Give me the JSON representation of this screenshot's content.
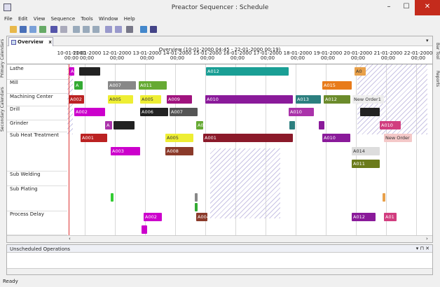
{
  "window": {
    "title": "Preactor Sequencer : Schedule",
    "minimize": "–",
    "maximize": "☐",
    "close": "✕"
  },
  "menu": [
    "File",
    "Edit",
    "View",
    "Sequence",
    "Tools",
    "Window",
    "Help"
  ],
  "left_tabs": [
    "Primary Calendars",
    "Secondary Calendars"
  ],
  "right_tabs": [
    "Bar Tool",
    "Reports"
  ],
  "doc_tab": {
    "label": "Overview",
    "close": "x",
    "menu": "▾"
  },
  "overview_label": "Overview   (10-01-2000 04:45 - 22-01-2000 00:19)",
  "dates": [
    {
      "d": "10-01-2000",
      "t": "00:00"
    },
    {
      "d": "11-01-2000",
      "t": "00;00"
    },
    {
      "d": "12-01-2000",
      "t": "00;00"
    },
    {
      "d": "13-01-2000",
      "t": "00;00"
    },
    {
      "d": "14-01-2000",
      "t": "00;00"
    },
    {
      "d": "15-01-2000",
      "t": "00;00"
    },
    {
      "d": "16-01-2000",
      "t": "00;00"
    },
    {
      "d": "17-01-2000",
      "t": "00;00"
    },
    {
      "d": "18-01-2000",
      "t": "00;00"
    },
    {
      "d": "19-01-2000",
      "t": "00;00"
    },
    {
      "d": "20-01-2000",
      "t": "00;00"
    },
    {
      "d": "21-01-2000",
      "t": "00;00"
    },
    {
      "d": "22-01-2000",
      "t": "00;00"
    }
  ],
  "resources": [
    {
      "name": "Lathe"
    },
    {
      "name": "Mill"
    },
    {
      "name": "Machining Center"
    },
    {
      "name": "Drill"
    },
    {
      "name": "Grinder"
    },
    {
      "name": "Sub Heat Treatment"
    },
    {
      "name": "Sub Welding"
    },
    {
      "name": "Sub Plating"
    },
    {
      "name": "Process Delay"
    }
  ],
  "ops": {
    "lathe": [
      "A0",
      "A012",
      "A0"
    ],
    "mill": [
      "A",
      "A007",
      "A011",
      "A015"
    ],
    "mc": [
      "A002",
      "A005",
      "A005",
      "A009",
      "A010",
      "A013",
      "A012",
      "A0",
      "New Order1"
    ],
    "drill": [
      "A002",
      "A006",
      "A007",
      "A010",
      "A0"
    ],
    "grinder": [
      "A",
      "A0",
      "A0",
      "A010",
      "A0",
      "A010"
    ],
    "heat": [
      "A001",
      "A003",
      "A005",
      "A008",
      "A001",
      "A010",
      "New Order",
      "A014",
      "A011"
    ],
    "delay": [
      "A002",
      "A004",
      "A012",
      "A01"
    ]
  },
  "unscheduled": {
    "title": "Unscheduled Operations",
    "pin": "▾ ⊓ ✕"
  },
  "status": "Ready",
  "colors": {
    "accent": "#c42b1c",
    "hatch": "#c9c3e4",
    "grid": "#d8d8d8"
  }
}
